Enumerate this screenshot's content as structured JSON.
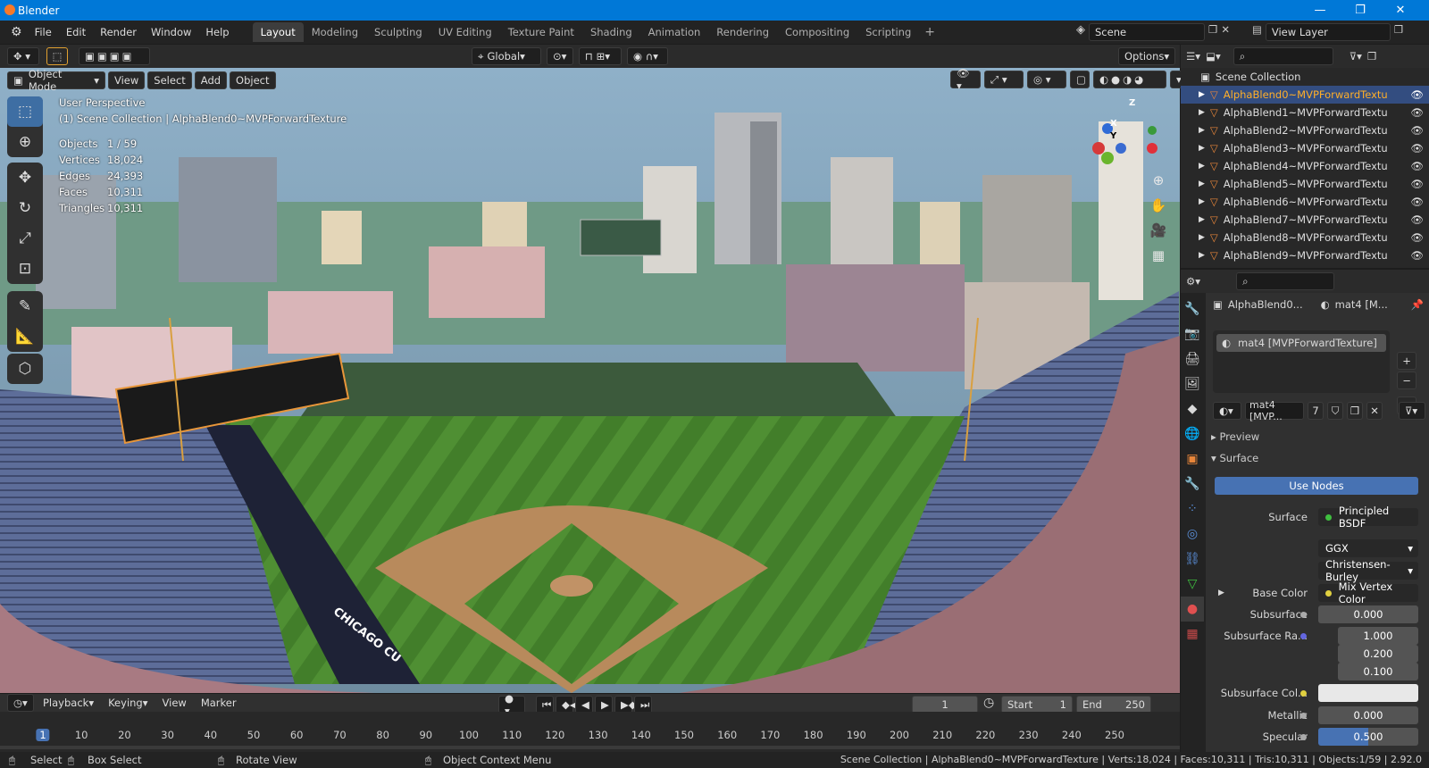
{
  "window": {
    "title": "Blender",
    "min": "—",
    "max": "❐",
    "close": "✕"
  },
  "menus": [
    "File",
    "Edit",
    "Render",
    "Window",
    "Help"
  ],
  "workspaces": [
    "Layout",
    "Modeling",
    "Sculpting",
    "UV Editing",
    "Texture Paint",
    "Shading",
    "Animation",
    "Rendering",
    "Compositing",
    "Scripting"
  ],
  "scene": {
    "name": "Scene",
    "view_layer": "View Layer"
  },
  "toolbar": {
    "orientation": "Global",
    "options": "Options"
  },
  "viewport": {
    "mode": "Object Mode",
    "menus": [
      "View",
      "Select",
      "Add",
      "Object"
    ],
    "perspective": "User Perspective",
    "collection_line": "(1) Scene Collection | AlphaBlend0~MVPForwardTexture",
    "stats": [
      {
        "k": "Objects",
        "v": "1 / 59"
      },
      {
        "k": "Vertices",
        "v": "18,024"
      },
      {
        "k": "Edges",
        "v": "24,393"
      },
      {
        "k": "Faces",
        "v": "10,311"
      },
      {
        "k": "Triangles",
        "v": "10,311"
      }
    ],
    "sign_text": "CHICAGO CU",
    "axis_labels": {
      "z": "Z",
      "x": "X",
      "y": "Y"
    }
  },
  "outliner": {
    "root": "Scene Collection",
    "items": [
      "AlphaBlend0~MVPForwardTextu",
      "AlphaBlend1~MVPForwardTextu",
      "AlphaBlend2~MVPForwardTextu",
      "AlphaBlend3~MVPForwardTextu",
      "AlphaBlend4~MVPForwardTextu",
      "AlphaBlend5~MVPForwardTextu",
      "AlphaBlend6~MVPForwardTextu",
      "AlphaBlend7~MVPForwardTextu",
      "AlphaBlend8~MVPForwardTextu",
      "AlphaBlend9~MVPForwardTextu"
    ]
  },
  "properties": {
    "object": "AlphaBlend0...",
    "material_short": "mat4 [M...",
    "slot": "mat4 [MVPForwardTexture]",
    "material_field": "mat4 [MVP...",
    "users": "7",
    "preview": "Preview",
    "surface_panel": "Surface",
    "use_nodes": "Use Nodes",
    "surface_label": "Surface",
    "surface_value": "Principled BSDF",
    "distribution": "GGX",
    "subsurface_method": "Christensen-Burley",
    "base_color_label": "Base Color",
    "base_color_value": "Mix Vertex Color",
    "subsurface_label": "Subsurface",
    "subsurface_value": "0.000",
    "subsurface_radius_label": "Subsurface Ra...",
    "radius": [
      "1.000",
      "0.200",
      "0.100"
    ],
    "subsurface_color_label": "Subsurface Col...",
    "metallic_label": "Metallic",
    "metallic_value": "0.000",
    "specular_label": "Specular",
    "specular_value": "0.500"
  },
  "timeline": {
    "menus": [
      "Playback",
      "Keying",
      "View",
      "Marker"
    ],
    "current": "1",
    "start_label": "Start",
    "start": "1",
    "end_label": "End",
    "end": "250",
    "ruler": [
      "1",
      "10",
      "20",
      "30",
      "40",
      "50",
      "60",
      "70",
      "80",
      "90",
      "100",
      "110",
      "120",
      "130",
      "140",
      "150",
      "160",
      "170",
      "180",
      "190",
      "200",
      "210",
      "220",
      "230",
      "240",
      "250"
    ]
  },
  "status": {
    "select": "Select",
    "box_select": "Box Select",
    "rotate": "Rotate View",
    "context": "Object Context Menu",
    "info": "Scene Collection | AlphaBlend0~MVPForwardTexture | Verts:18,024 | Faces:10,311 | Tris:10,311 | Objects:1/59 | 2.92.0"
  },
  "colors": {
    "accent": "#4772b3",
    "selected_row": "#334d80",
    "active_text": "#ffaf29",
    "grass": "#4a8a2e",
    "dirt": "#b88a5c"
  }
}
